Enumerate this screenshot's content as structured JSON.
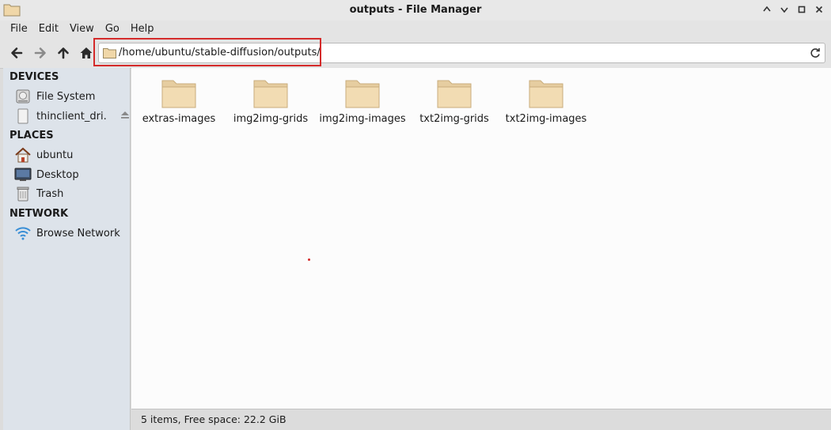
{
  "window": {
    "title": "outputs - File Manager",
    "icon": "folder-icon",
    "controls": [
      "minimize-icon",
      "maximize-icon",
      "close-icon"
    ]
  },
  "menu": {
    "items": [
      "File",
      "Edit",
      "View",
      "Go",
      "Help"
    ]
  },
  "toolbar": {
    "buttons": [
      "back-arrow-icon",
      "forward-arrow-icon",
      "up-arrow-icon",
      "home-icon"
    ],
    "location": "/home/ubuntu/stable-diffusion/outputs/",
    "highlight_color": "#d42a2a"
  },
  "sidebar": {
    "devices": {
      "heading": "DEVICES",
      "items": [
        {
          "label": "File System",
          "icon": "hard-drive-icon"
        },
        {
          "label": "thinclient_dri...",
          "icon": "drive-icon",
          "eject": "eject-icon"
        }
      ]
    },
    "places": {
      "heading": "PLACES",
      "items": [
        {
          "label": "ubuntu",
          "icon": "home-folder-icon"
        },
        {
          "label": "Desktop",
          "icon": "desktop-icon"
        },
        {
          "label": "Trash",
          "icon": "trash-icon"
        }
      ]
    },
    "network": {
      "heading": "NETWORK",
      "items": [
        {
          "label": "Browse Network",
          "icon": "network-wifi-icon"
        }
      ]
    }
  },
  "main": {
    "folders": [
      {
        "name": "extras-images"
      },
      {
        "name": "img2img-grids"
      },
      {
        "name": "img2img-images"
      },
      {
        "name": "txt2img-grids"
      },
      {
        "name": "txt2img-images"
      }
    ]
  },
  "status": "5 items, Free space: 22.2 GiB",
  "colors": {
    "folder": "#f0d9ae",
    "sidebar": "#dde3ea",
    "accent": "#d42a2a"
  }
}
